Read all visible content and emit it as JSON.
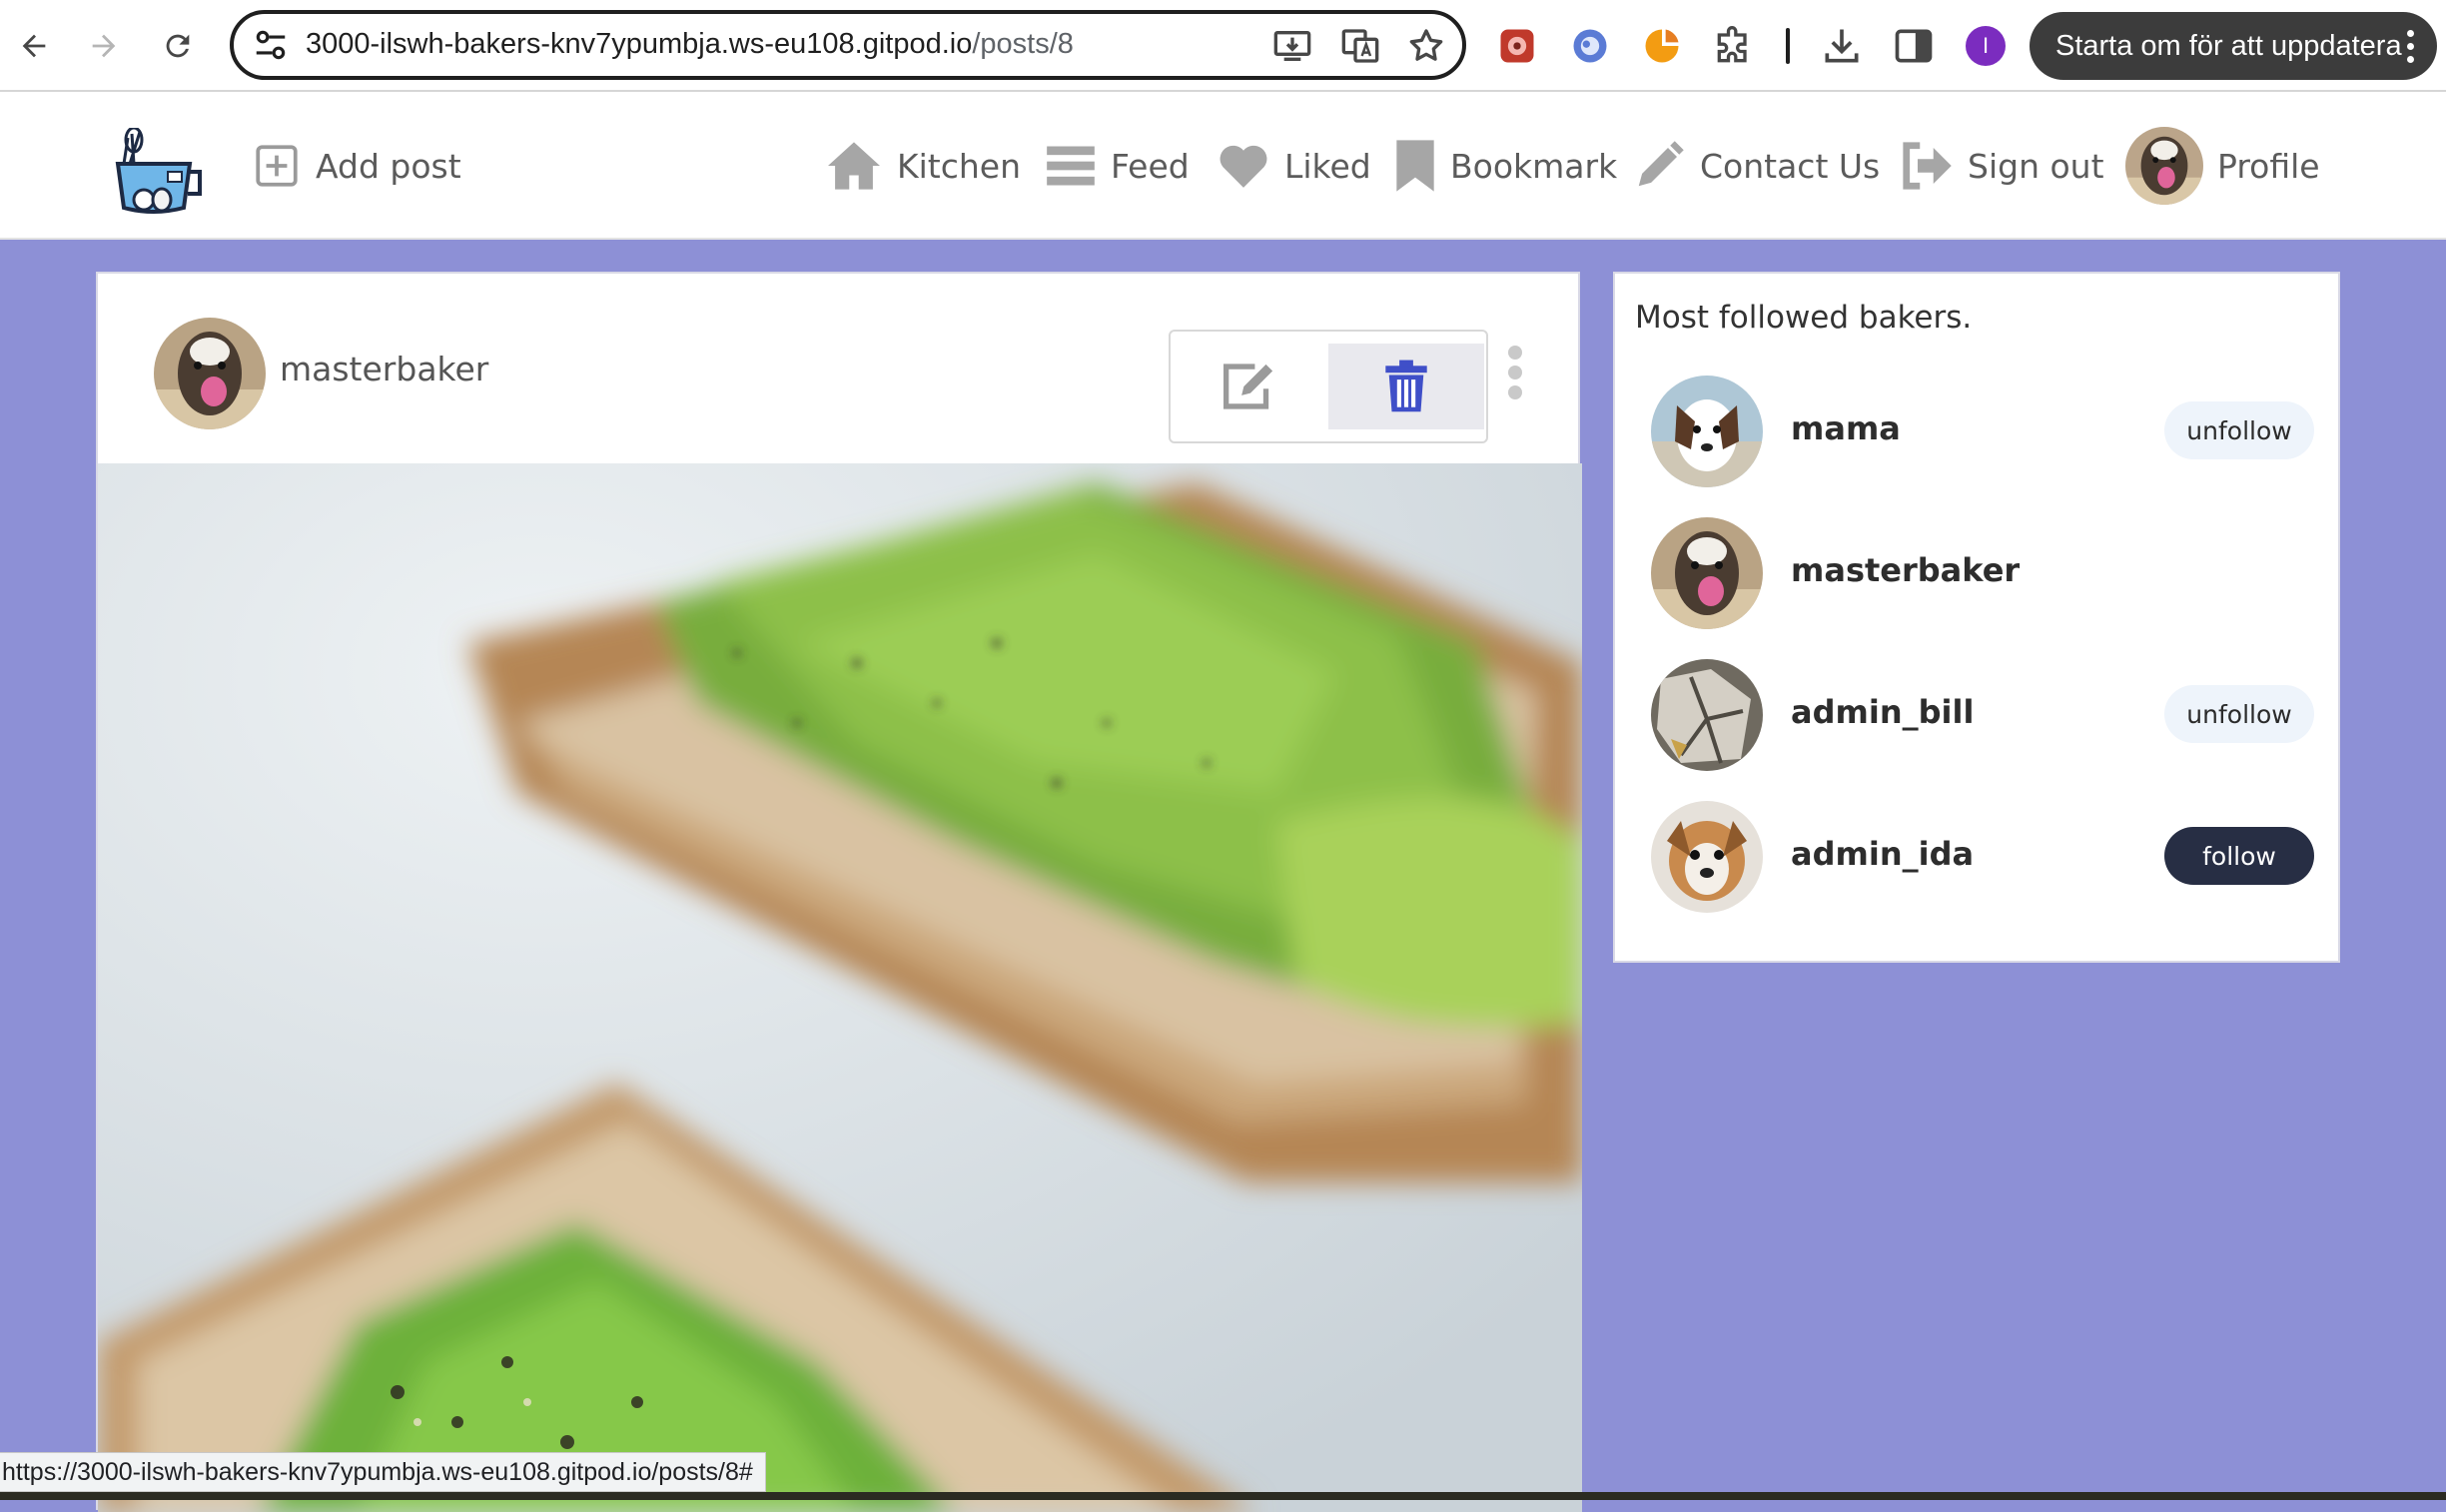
{
  "browser": {
    "url_host": "3000-ilswh-bakers-knv7ypumbja.ws-eu108.gitpod.io",
    "url_path": "/posts/8",
    "profile_initial": "I",
    "update_button": "Starta om för att uppdatera",
    "status_url": "https://3000-ilswh-bakers-knv7ypumbja.ws-eu108.gitpod.io/posts/8#"
  },
  "navbar": {
    "add_post": "Add post",
    "items": [
      {
        "label": "Kitchen",
        "icon": "home-icon"
      },
      {
        "label": "Feed",
        "icon": "bars-icon"
      },
      {
        "label": "Liked",
        "icon": "heart-icon"
      },
      {
        "label": "Bookmark",
        "icon": "bookmark-icon"
      },
      {
        "label": "Contact Us",
        "icon": "pencil-icon"
      },
      {
        "label": "Sign out",
        "icon": "sign-out-icon"
      },
      {
        "label": "Profile",
        "icon": "avatar"
      }
    ]
  },
  "post": {
    "author": "masterbaker",
    "image_subject": "avocado toast"
  },
  "sidebar": {
    "title": "Most followed bakers.",
    "bakers": [
      {
        "name": "mama",
        "action": "unfollow"
      },
      {
        "name": "masterbaker",
        "action": ""
      },
      {
        "name": "admin_bill",
        "action": "unfollow"
      },
      {
        "name": "admin_ida",
        "action": "follow"
      }
    ]
  },
  "colors": {
    "page_background": "#8d90d6",
    "delete_icon": "#3f4fc8",
    "follow_button": "#272e44",
    "unfollow_button": "#eef4fb"
  }
}
